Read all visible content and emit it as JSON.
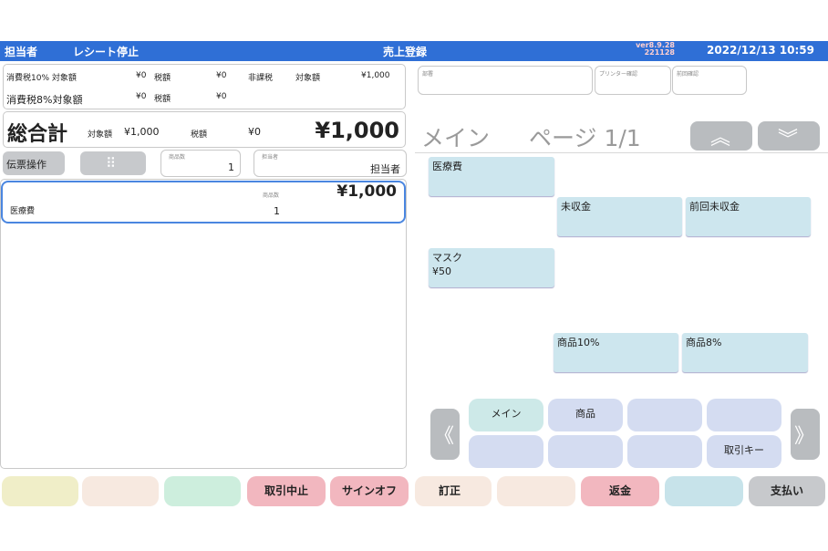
{
  "header": {
    "staff_label": "担当者",
    "receipt_stop": "レシート停止",
    "screen_title": "売上登録",
    "version_line1": "ver8.9.28",
    "version_line2": "221128",
    "datetime": "2022/12/13 10:59"
  },
  "tax_summary": {
    "row1": {
      "label": "消費税10% 対象額",
      "base": "¥0",
      "tax_label": "税額",
      "tax": "¥0",
      "nontax_label": "非課税",
      "nontax_base_label": "対象額",
      "nontax_base": "¥1,000"
    },
    "row2": {
      "label": "消費税8%対象額",
      "base": "¥0",
      "tax_label": "税額",
      "tax": "¥0"
    }
  },
  "total": {
    "label": "総合計",
    "base_label": "対象額",
    "base": "¥1,000",
    "tax_label": "税額",
    "tax": "¥0",
    "amount": "¥1,000"
  },
  "controls": {
    "slip_ops": "伝票操作",
    "keypad_icon": "keypad-icon",
    "item_count_label": "商品数",
    "item_count": "1",
    "staff_field_label": "担当者",
    "staff_name": "担当者"
  },
  "line_items": [
    {
      "name": "医療費",
      "qty_label": "商品数",
      "qty": "1",
      "price": "¥1,000"
    }
  ],
  "right_fields": {
    "department_label": "部署",
    "printer_label": "プリンター確認",
    "prev_label": "前回確認"
  },
  "page_header": {
    "title": "メイン",
    "page": "ページ 1/1"
  },
  "product_keys": [
    {
      "label": "医療費"
    },
    {
      "label": "未収金"
    },
    {
      "label": "前回未収金"
    },
    {
      "label": "マスク\n¥50"
    },
    {
      "label": "商品10%"
    },
    {
      "label": "商品8%"
    }
  ],
  "categories": {
    "main": "メイン",
    "product": "商品",
    "blank1": "",
    "blank2": "",
    "blank3": "",
    "blank4": "",
    "blank5": "",
    "txn_key": "取引キー"
  },
  "bottom_buttons": {
    "b1": "",
    "b2": "",
    "b3": "",
    "cancel_txn": "取引中止",
    "sign_off": "サインオフ",
    "correction": "訂正",
    "b7": "",
    "refund": "返金",
    "b9": "",
    "payment": "支払い"
  },
  "colors": {
    "header_bg": "#2f6fd6",
    "key_bg": "#cde6ee",
    "category_bg": "#d4dcf1",
    "refund_bg": "#f2b7bf",
    "payment_bg": "#c7c9cc"
  }
}
